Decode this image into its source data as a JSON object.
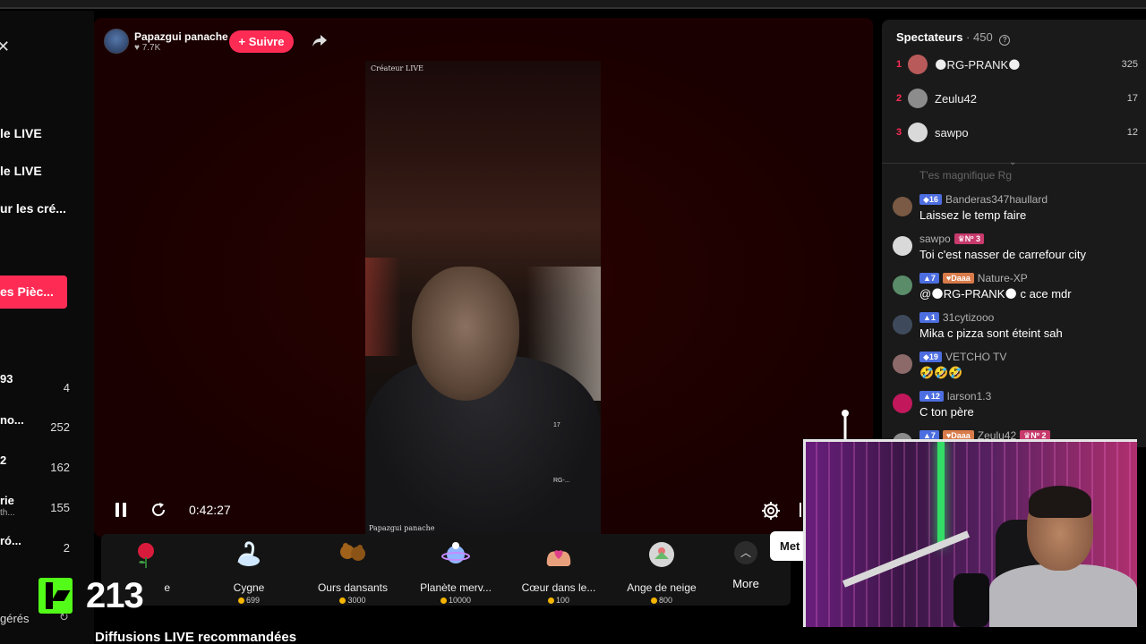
{
  "sidebar": {
    "links": [
      "le LIVE",
      "le LIVE",
      "ur les cré..."
    ],
    "coins_button": "es Pièc...",
    "ranking": [
      {
        "name": "93",
        "sub": "",
        "value": "4"
      },
      {
        "name": "no...",
        "sub": "",
        "value": "252"
      },
      {
        "name": "2",
        "sub": "",
        "value": "162"
      },
      {
        "name": "rie",
        "sub": "th...",
        "value": "155"
      },
      {
        "name": "ró...",
        "sub": "",
        "value": "2"
      }
    ],
    "footer": "gérés"
  },
  "host": {
    "name": "Papazgui panache",
    "likes": "7.7K",
    "follow_label": "+ Suivre"
  },
  "video": {
    "caption_top": "Créateur LIVE",
    "caption_bottom": "Papazgui panache",
    "tag_count": "17",
    "tag_name": "RG-..."
  },
  "player": {
    "time": "0:42:27"
  },
  "gifts": [
    {
      "name": "e",
      "price": "",
      "icon": "rose-icon",
      "color": "#d81b3c"
    },
    {
      "name": "Cygne",
      "price": "699",
      "icon": "swan-icon",
      "color": "#cfe8ff"
    },
    {
      "name": "Ours dansants",
      "price": "3000",
      "icon": "dancing-bears-icon",
      "color": "#a0621a"
    },
    {
      "name": "Planète merv...",
      "price": "10000",
      "icon": "planet-icon",
      "color": "#8fb6ff"
    },
    {
      "name": "Cœur dans le...",
      "price": "100",
      "icon": "heart-hands-icon",
      "color": "#e8a07c"
    },
    {
      "name": "Ange de neige",
      "price": "800",
      "icon": "snow-angel-icon",
      "color": "#d6d6d6"
    }
  ],
  "more_label": "More",
  "send_chip": "Met",
  "kick": {
    "count": "213"
  },
  "recommended_title": "Diffusions LIVE recommandées",
  "spectators": {
    "title": "Spectateurs",
    "count": "· 450",
    "top": [
      {
        "rank": "1",
        "name": "🌑RG-PRANK🌑",
        "score": "325",
        "color": "#b85a5a"
      },
      {
        "rank": "2",
        "name": "Zeulu42",
        "score": "17",
        "color": "#8c8c8c"
      },
      {
        "rank": "3",
        "name": "sawpo",
        "score": "12",
        "color": "#d9d9d9"
      }
    ]
  },
  "chat": {
    "ghost": "T'es magnifique Rg",
    "messages": [
      {
        "badges": [
          {
            "text": "◆16",
            "kind": "blue"
          }
        ],
        "user": "Banderas347haullard",
        "text": "Laissez le temp faire",
        "avatar": "#7a5a44"
      },
      {
        "badges": [
          {
            "text": "♛Nº 3",
            "kind": "pink"
          }
        ],
        "user": "sawpo",
        "text": "Toi c'est nasser de carrefour city",
        "avatar": "#d9d9d9"
      },
      {
        "badges": [
          {
            "text": "▲7",
            "kind": "blue"
          },
          {
            "text": "♥Daaa",
            "kind": "orange"
          }
        ],
        "user": "Nature-XP",
        "text": "@🌑RG-PRANK🌑 c ace mdr",
        "avatar": "#5a8c6a"
      },
      {
        "badges": [
          {
            "text": "▲1",
            "kind": "blue"
          }
        ],
        "user": "31cytizooo",
        "text": "Mika c pizza sont éteint sah",
        "avatar": "#3e4a5c"
      },
      {
        "badges": [
          {
            "text": "◆19",
            "kind": "blue"
          }
        ],
        "user": "VETCHO TV",
        "text": "🤣🤣🤣",
        "avatar": "#8c6a6a"
      },
      {
        "badges": [
          {
            "text": "▲12",
            "kind": "blue"
          }
        ],
        "user": "larson1.3",
        "text": "C ton père",
        "avatar": "#c2185b"
      },
      {
        "badges": [
          {
            "text": "▲7",
            "kind": "blue"
          },
          {
            "text": "♥Daaa",
            "kind": "orange"
          },
          {
            "text": "♛Nº 2",
            "kind": "pink"
          }
        ],
        "user": "Zeulu42",
        "text": "",
        "avatar": "#8c8c8c"
      }
    ]
  }
}
